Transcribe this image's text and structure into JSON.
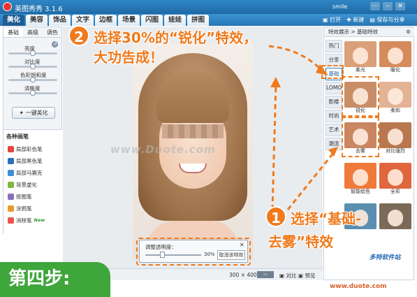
{
  "window": {
    "title": "美图秀秀 3.1.6",
    "user": "smile",
    "controls": [
      "⋯",
      "–",
      "✕"
    ]
  },
  "toolbar": {
    "tabs": [
      "美化",
      "美容",
      "饰品",
      "文字",
      "边框",
      "场景",
      "闪图",
      "娃娃",
      "拼图"
    ],
    "active_tab": "美化",
    "open_label": "打开",
    "new_label": "新建",
    "save_label": "保存与分享"
  },
  "left_panel": {
    "tabs": [
      "基础",
      "高级",
      "调色"
    ],
    "sliders": [
      {
        "label": "亮度",
        "value": 0.5
      },
      {
        "label": "对比度",
        "value": 0.5
      },
      {
        "label": "色彩饱和度",
        "value": 0.5
      },
      {
        "label": "清晰度",
        "value": 0.5
      }
    ],
    "one_key_label": "一键美化",
    "pens_title": "各种画笔",
    "pens": [
      {
        "label": "局部彩色笔",
        "icon": "color-pen-icon",
        "color": "#e0463a"
      },
      {
        "label": "局部黑色笔",
        "icon": "black-pen-icon",
        "color": "#2d6fb4"
      },
      {
        "label": "局部马赛克",
        "icon": "mosaic-icon",
        "color": "#3c8fd6"
      },
      {
        "label": "背景虚化",
        "icon": "blur-icon",
        "color": "#7fb542"
      },
      {
        "label": "抠图笔",
        "icon": "cutout-pen-icon",
        "color": "#8a6fb8"
      },
      {
        "label": "涂鸦笔",
        "icon": "doodle-pen-icon",
        "color": "#e89a2d"
      },
      {
        "label": "消除笔",
        "icon": "eraser-pen-icon",
        "color": "#e8554b",
        "badge": "New"
      }
    ]
  },
  "canvas": {
    "watermark": "www.Duote.com",
    "image_size": "300 × 400",
    "compare_label": "对比",
    "preview_label": "预览"
  },
  "opacity_dialog": {
    "title": "调整透明度：",
    "percent": "30%",
    "value": 0.3,
    "cancel_label": "取消该特效"
  },
  "right_panel": {
    "header": "特效展示 > 基础特效",
    "categories": [
      "热门",
      "分享",
      "基础",
      "LOMO",
      "影楼",
      "时尚",
      "艺术",
      "潮流"
    ],
    "selected_category": "基础",
    "effects": [
      {
        "label": "柔光",
        "color": "#d9a07a"
      },
      {
        "label": "暖化",
        "color": "#d58b5c"
      },
      {
        "label": "锐化",
        "color": "#c98e68"
      },
      {
        "label": "柔和",
        "color": "#e2b394"
      },
      {
        "label": "去雾",
        "color": "#c98660"
      },
      {
        "label": "对比强烈",
        "color": "#b9774f"
      },
      {
        "label": "智能绘色",
        "color": "#f07a3a"
      },
      {
        "label": "全彩",
        "color": "#e0663e"
      },
      {
        "label": "",
        "color": "#5a8fb0"
      },
      {
        "label": "",
        "color": "#7b6a58"
      }
    ]
  },
  "annotations": {
    "step2_number": "2",
    "step2_text_line1": "选择30%的“锐化”特效，",
    "step2_text_line2": "大功告成！",
    "step1_number": "1",
    "step1_text_line1": "选择“基础-",
    "step1_text_line2": "去雾”特效",
    "step_label": "第四步:",
    "site": "www.duote.com",
    "logo": "多特软件站"
  }
}
